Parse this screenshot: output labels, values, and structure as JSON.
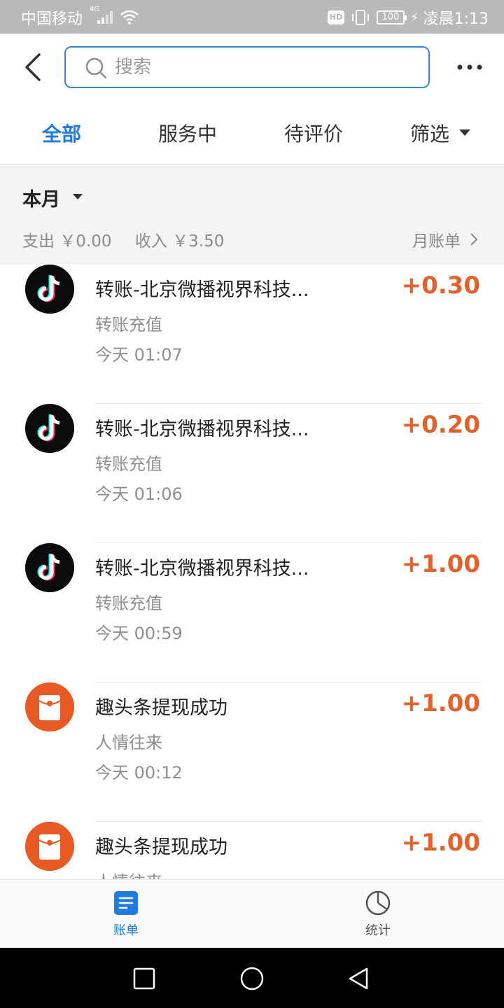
{
  "status_bar": {
    "carrier": "中国移动",
    "network": "4G",
    "hd": "HD",
    "battery": "100",
    "time": "凌晨1:13"
  },
  "header": {
    "search_placeholder": "搜索"
  },
  "tabs": [
    {
      "label": "全部",
      "active": true
    },
    {
      "label": "服务中",
      "active": false
    },
    {
      "label": "待评价",
      "active": false
    },
    {
      "label": "筛选",
      "active": false
    }
  ],
  "summary": {
    "month": "本月",
    "expense": "支出 ￥0.00",
    "income": "收入 ￥3.50",
    "monthly_bill": "月账单"
  },
  "transactions": [
    {
      "icon": "tiktok-icon",
      "title": "转账-北京微播视界科技...",
      "category": "转账充值",
      "time": "今天  01:07",
      "amount": "+0.30"
    },
    {
      "icon": "tiktok-icon",
      "title": "转账-北京微播视界科技...",
      "category": "转账充值",
      "time": "今天  01:06",
      "amount": "+0.20"
    },
    {
      "icon": "tiktok-icon",
      "title": "转账-北京微播视界科技...",
      "category": "转账充值",
      "time": "今天  00:59",
      "amount": "+1.00"
    },
    {
      "icon": "red-envelope-icon",
      "title": "趣头条提现成功",
      "category": "人情往来",
      "time": "今天  00:12",
      "amount": "+1.00"
    },
    {
      "icon": "red-envelope-icon",
      "title": "趣头条提现成功",
      "category": "人情往来",
      "time": "",
      "amount": "+1.00"
    }
  ],
  "bottom_nav": {
    "bills": "账单",
    "stats": "统计"
  },
  "colors": {
    "accent": "#1f7be0",
    "amount": "#e2622d",
    "envelope": "#e85a24"
  }
}
